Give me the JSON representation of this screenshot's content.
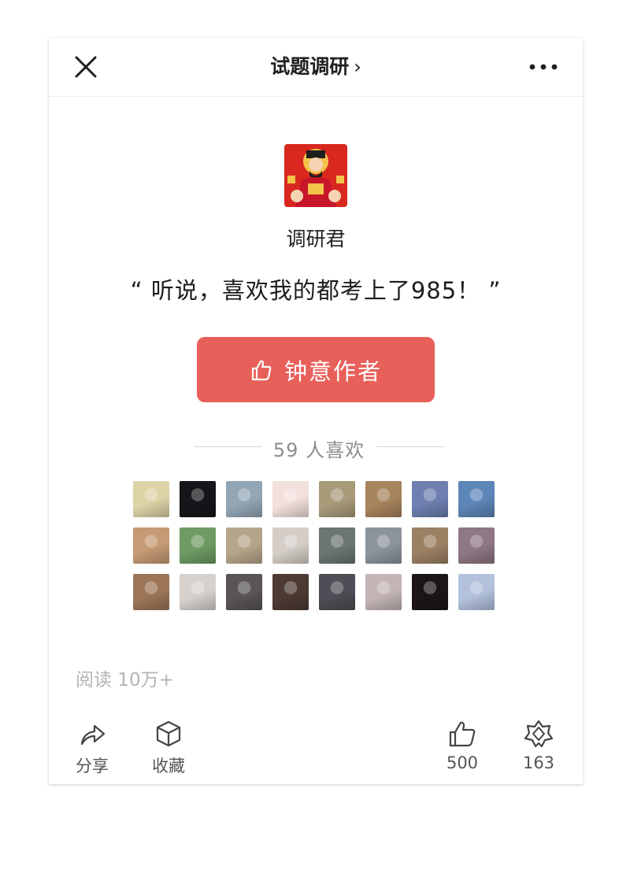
{
  "topbar": {
    "title": "试题调研",
    "chevron": "›",
    "close_icon": "close-icon",
    "more_icon": "more-dots-icon"
  },
  "author": {
    "name": "调研君",
    "quote": "“ 听说，喜欢我的都考上了985！ ”"
  },
  "like_author": {
    "label": "钟意作者",
    "icon": "thumb-up-icon",
    "color": "#e8605a"
  },
  "likes": {
    "text": "59 人喜欢"
  },
  "liker_avatars": [
    "#dcd3a6",
    "#16161a",
    "#93a6b6",
    "#f3e0dc",
    "#a99a7a",
    "#a7845c",
    "#6e7fb0",
    "#5d86b8",
    "#c59a74",
    "#6e9b63",
    "#b7a58b",
    "#d5cec8",
    "#6c7670",
    "#8c939c",
    "#9c8064",
    "#8f7785",
    "#9c7556",
    "#d6d1cd",
    "#585458",
    "#4d3a33",
    "#4f4d55",
    "#c2b5b3",
    "#1c1518",
    "#b3c1dd"
  ],
  "stats": {
    "read": "阅读 10万+"
  },
  "actions": {
    "share_label": "分享",
    "collect_label": "收藏",
    "like_count": "500",
    "wow_count": "163"
  }
}
